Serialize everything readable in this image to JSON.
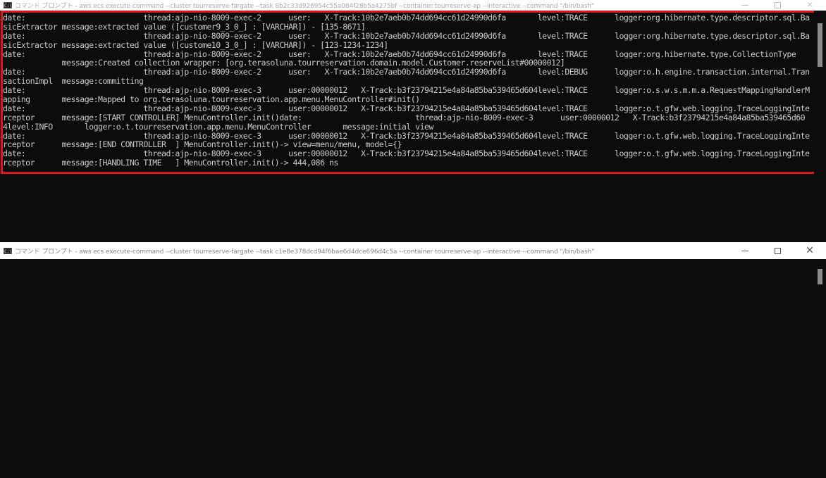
{
  "window_top": {
    "title_icon_glyph": "C:\\",
    "title": "コマンド プロンプト - aws  ecs execute-command --cluster tourreserve-fargate --task 8b2c33d926954c55a084f28b5a4275bf --container tourreserve-ap --interactive --command \"/bin/bash\"",
    "controls": {
      "minimize": "",
      "maximize": "",
      "close": "✕"
    },
    "lines": [
      "date:                          thread:ajp-nio-8009-exec-2      user:   X-Track:10b2e7aeb0b74dd694cc61d24990d6fa       level:TRACE      logger:org.hibernate.type.descriptor.sql.Ba",
      "sicExtractor message:extracted value ([customer9_3_0_] : [VARCHAR]) - [135-8671]",
      "date:                          thread:ajp-nio-8009-exec-2      user:   X-Track:10b2e7aeb0b74dd694cc61d24990d6fa       level:TRACE      logger:org.hibernate.type.descriptor.sql.Ba",
      "sicExtractor message:extracted value ([custome10_3_0_] : [VARCHAR]) - [123-1234-1234]",
      "date:                          thread:ajp-nio-8009-exec-2      user:   X-Track:10b2e7aeb0b74dd694cc61d24990d6fa       level:TRACE      logger:org.hibernate.type.CollectionType",
      "             message:Created collection wrapper: [org.terasoluna.tourreservation.domain.model.Customer.reserveList#00000012]",
      "date:                          thread:ajp-nio-8009-exec-2      user:   X-Track:10b2e7aeb0b74dd694cc61d24990d6fa       level:DEBUG      logger:o.h.engine.transaction.internal.Tran",
      "sactionImpl  message:committing",
      "date:                          thread:ajp-nio-8009-exec-3      user:00000012   X-Track:b3f23794215e4a84a85ba539465d604level:TRACE      logger:o.s.w.s.m.m.a.RequestMappingHandlerM",
      "apping       message:Mapped to org.terasoluna.tourreservation.app.menu.MenuController#init()",
      "date:                          thread:ajp-nio-8009-exec-3      user:00000012   X-Track:b3f23794215e4a84a85ba539465d604level:TRACE      logger:o.t.gfw.web.logging.TraceLoggingInte",
      "rceptor      message:[START CONTROLLER] MenuController.init()date:                         thread:ajp-nio-8009-exec-3      user:00000012   X-Track:b3f23794215e4a84a85ba539465d60",
      "4level:INFO       logger:o.t.tourreservation.app.menu.MenuController       message:initial view",
      "date:                          thread:ajp-nio-8009-exec-3      user:00000012   X-Track:b3f23794215e4a84a85ba539465d604level:TRACE      logger:o.t.gfw.web.logging.TraceLoggingInte",
      "rceptor      message:[END CONTROLLER  ] MenuController.init()-> view=menu/menu, model={}",
      "date:                          thread:ajp-nio-8009-exec-3      user:00000012   X-Track:b3f23794215e4a84a85ba539465d604level:TRACE      logger:o.t.gfw.web.logging.TraceLoggingInte",
      "rceptor      message:[HANDLING TIME   ] MenuController.init()-> 444,086 ns"
    ]
  },
  "window_bottom": {
    "title_icon_glyph": "C:\\",
    "title": "コマンド プロンプト - aws  ecs execute-command --cluster tourreserve-fargate --task c1e8e378dcd94f6bae6d4dce696d4c5a --container tourreserve-ap --interactive --command \"/bin/bash\"",
    "controls": {
      "minimize": "",
      "maximize": "",
      "close": "✕"
    },
    "lines": []
  },
  "colors": {
    "highlight_border": "#e0141e",
    "console_background": "#0c0c0c",
    "console_text": "#c8c8c8"
  },
  "icons": [
    "cmd-icon",
    "minimize-icon",
    "maximize-icon",
    "close-icon"
  ]
}
